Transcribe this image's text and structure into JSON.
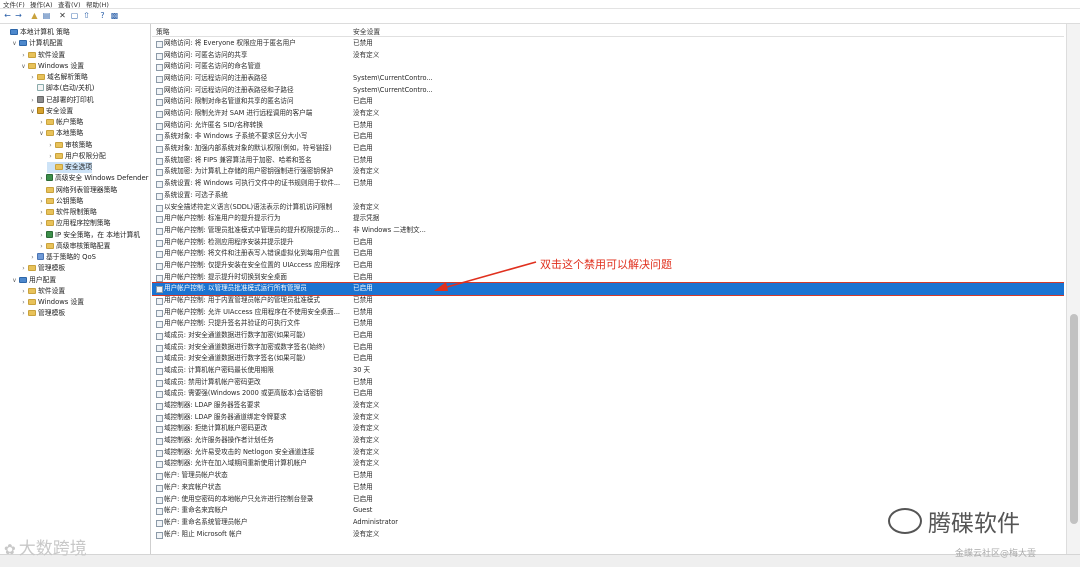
{
  "menu": {
    "items": [
      "文件(F)",
      "操作(A)",
      "查看(V)",
      "帮助(H)"
    ]
  },
  "toolbar": {
    "icons": [
      "back-arrow-icon",
      "forward-arrow-icon",
      "up-folder-icon",
      "show-tree-icon",
      "delete-icon",
      "properties-icon",
      "export-icon",
      "help-icon",
      "console-icon"
    ]
  },
  "tree": [
    {
      "label": "本地计算机 策略",
      "indent": 0,
      "toggle": "",
      "icon": "pc"
    },
    {
      "label": "计算机配置",
      "indent": 1,
      "toggle": "v",
      "icon": "pc"
    },
    {
      "label": "软件设置",
      "indent": 2,
      "toggle": ">",
      "icon": "folder"
    },
    {
      "label": "Windows 设置",
      "indent": 2,
      "toggle": "v",
      "icon": "folder"
    },
    {
      "label": "域名解析策略",
      "indent": 3,
      "toggle": ">",
      "icon": "folder"
    },
    {
      "label": "脚本(启动/关机)",
      "indent": 3,
      "toggle": "",
      "icon": "doc"
    },
    {
      "label": "已部署的打印机",
      "indent": 3,
      "toggle": ">",
      "icon": "printer"
    },
    {
      "label": "安全设置",
      "indent": 3,
      "toggle": "v",
      "icon": "lock"
    },
    {
      "label": "帐户策略",
      "indent": 4,
      "toggle": ">",
      "icon": "folder"
    },
    {
      "label": "本地策略",
      "indent": 4,
      "toggle": "v",
      "icon": "folder"
    },
    {
      "label": "审核策略",
      "indent": 5,
      "toggle": ">",
      "icon": "folder"
    },
    {
      "label": "用户权限分配",
      "indent": 5,
      "toggle": ">",
      "icon": "folder"
    },
    {
      "label": "安全选项",
      "indent": 5,
      "toggle": "",
      "icon": "folder",
      "selected": true
    },
    {
      "label": "高级安全 Windows Defender",
      "indent": 4,
      "toggle": ">",
      "icon": "shield"
    },
    {
      "label": "网络列表管理器策略",
      "indent": 4,
      "toggle": "",
      "icon": "folder"
    },
    {
      "label": "公钥策略",
      "indent": 4,
      "toggle": ">",
      "icon": "folder"
    },
    {
      "label": "软件限制策略",
      "indent": 4,
      "toggle": ">",
      "icon": "folder"
    },
    {
      "label": "应用程序控制策略",
      "indent": 4,
      "toggle": ">",
      "icon": "folder"
    },
    {
      "label": "IP 安全策略，在 本地计算机",
      "indent": 4,
      "toggle": ">",
      "icon": "shield"
    },
    {
      "label": "高级审核策略配置",
      "indent": 4,
      "toggle": ">",
      "icon": "folder"
    },
    {
      "label": "基于策略的 QoS",
      "indent": 3,
      "toggle": ">",
      "icon": "chart"
    },
    {
      "label": "管理模板",
      "indent": 2,
      "toggle": ">",
      "icon": "folder"
    },
    {
      "label": "用户配置",
      "indent": 1,
      "toggle": "v",
      "icon": "pc"
    },
    {
      "label": "软件设置",
      "indent": 2,
      "toggle": ">",
      "icon": "folder"
    },
    {
      "label": "Windows 设置",
      "indent": 2,
      "toggle": ">",
      "icon": "folder"
    },
    {
      "label": "管理模板",
      "indent": 2,
      "toggle": ">",
      "icon": "folder"
    }
  ],
  "list": {
    "col_policy": "策略",
    "col_setting": "安全设置",
    "rows": [
      {
        "policy": "网络访问: 将 Everyone 权限应用于匿名用户",
        "setting": "已禁用"
      },
      {
        "policy": "网络访问: 可匿名访问的共享",
        "setting": "没有定义"
      },
      {
        "policy": "网络访问: 可匿名访问的命名管道",
        "setting": ""
      },
      {
        "policy": "网络访问: 可远程访问的注册表路径",
        "setting": "System\\CurrentContro..."
      },
      {
        "policy": "网络访问: 可远程访问的注册表路径和子路径",
        "setting": "System\\CurrentContro..."
      },
      {
        "policy": "网络访问: 限制对命名管道和共享的匿名访问",
        "setting": "已启用"
      },
      {
        "policy": "网络访问: 限制允许对 SAM 进行远程调用的客户端",
        "setting": "没有定义"
      },
      {
        "policy": "网络访问: 允许匿名 SID/名称转换",
        "setting": "已禁用"
      },
      {
        "policy": "系统对象: 非 Windows 子系统不要求区分大小写",
        "setting": "已启用"
      },
      {
        "policy": "系统对象: 加强内部系统对象的默认权限(例如，符号链接)",
        "setting": "已启用"
      },
      {
        "policy": "系统加密: 将 FIPS 兼容算法用于加密、哈希和签名",
        "setting": "已禁用"
      },
      {
        "policy": "系统加密: 为计算机上存储的用户密钥强制进行强密钥保护",
        "setting": "没有定义"
      },
      {
        "policy": "系统设置: 将 Windows 可执行文件中的证书规则用于软件...",
        "setting": "已禁用"
      },
      {
        "policy": "系统设置: 可选子系统",
        "setting": ""
      },
      {
        "policy": "以安全描述符定义语言(SDDL)语法表示的计算机访问限制",
        "setting": "没有定义"
      },
      {
        "policy": "用户帐户控制: 标准用户的提升提示行为",
        "setting": "提示凭据"
      },
      {
        "policy": "用户帐户控制: 管理员批准模式中管理员的提升权限提示的...",
        "setting": "非 Windows 二进制文..."
      },
      {
        "policy": "用户帐户控制: 检测应用程序安装并提示提升",
        "setting": "已启用"
      },
      {
        "policy": "用户帐户控制: 将文件和注册表写入错误虚拟化到每用户位置",
        "setting": "已启用"
      },
      {
        "policy": "用户帐户控制: 仅提升安装在安全位置的 UIAccess 应用程序",
        "setting": "已启用"
      },
      {
        "policy": "用户帐户控制: 提示提升时切换到安全桌面",
        "setting": "已启用"
      },
      {
        "policy": "用户帐户控制: 以管理员批准模式运行所有管理员",
        "setting": "已启用",
        "selected": true
      },
      {
        "policy": "用户帐户控制: 用于内置管理员帐户的管理员批准模式",
        "setting": "已禁用"
      },
      {
        "policy": "用户帐户控制: 允许 UIAccess 应用程序在不使用安全桌面...",
        "setting": "已禁用"
      },
      {
        "policy": "用户帐户控制: 只提升签名并验证的可执行文件",
        "setting": "已禁用"
      },
      {
        "policy": "域成员: 对安全通道数据进行数字加密(如果可能)",
        "setting": "已启用"
      },
      {
        "policy": "域成员: 对安全通道数据进行数字加密或数字签名(始终)",
        "setting": "已启用"
      },
      {
        "policy": "域成员: 对安全通道数据进行数字签名(如果可能)",
        "setting": "已启用"
      },
      {
        "policy": "域成员: 计算机帐户密码最长使用期限",
        "setting": "30 天"
      },
      {
        "policy": "域成员: 禁用计算机帐户密码更改",
        "setting": "已禁用"
      },
      {
        "policy": "域成员: 需要强(Windows 2000 或更高版本)会话密钥",
        "setting": "已启用"
      },
      {
        "policy": "域控制器: LDAP 服务器签名要求",
        "setting": "没有定义"
      },
      {
        "policy": "域控制器: LDAP 服务器通道绑定令牌要求",
        "setting": "没有定义"
      },
      {
        "policy": "域控制器: 拒绝计算机帐户密码更改",
        "setting": "没有定义"
      },
      {
        "policy": "域控制器: 允许服务器操作者计划任务",
        "setting": "没有定义"
      },
      {
        "policy": "域控制器: 允许易受攻击的 Netlogon 安全通道连接",
        "setting": "没有定义"
      },
      {
        "policy": "域控制器: 允许在加入域期间重新使用计算机帐户",
        "setting": "没有定义"
      },
      {
        "policy": "帐户: 管理员帐户状态",
        "setting": "已禁用"
      },
      {
        "policy": "帐户: 来宾帐户状态",
        "setting": "已禁用"
      },
      {
        "policy": "帐户: 使用空密码的本地帐户只允许进行控制台登录",
        "setting": "已启用"
      },
      {
        "policy": "帐户: 重命名来宾帐户",
        "setting": "Guest"
      },
      {
        "policy": "帐户: 重命名系统管理员帐户",
        "setting": "Administrator"
      },
      {
        "policy": "帐户: 阻止 Microsoft 帐户",
        "setting": "没有定义"
      }
    ]
  },
  "annotation": {
    "text": "双击这个禁用可以解决问题",
    "color": "#e0301e"
  },
  "watermarks": {
    "left": "大数跨境",
    "right": "腾碟软件",
    "bottom": "金蝶云社区@梅大雲"
  },
  "colors": {
    "selection": "#1a73d1",
    "highlight_border": "#d23a2a"
  }
}
